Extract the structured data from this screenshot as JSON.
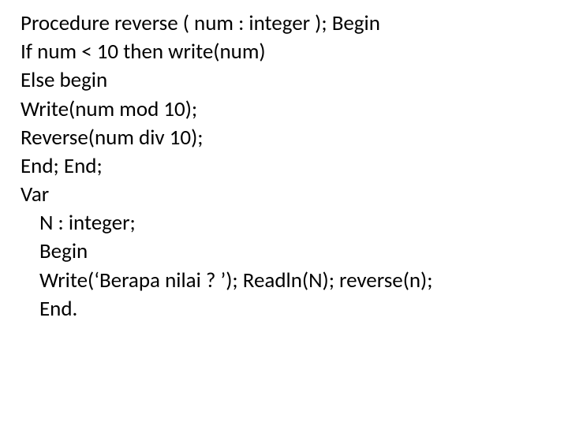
{
  "code": {
    "lines": [
      {
        "text": "Procedure reverse ( num : integer ); Begin",
        "indent": false
      },
      {
        "text": "If num < 10 then write(num)",
        "indent": false
      },
      {
        "text": "Else begin",
        "indent": false
      },
      {
        "text": "Write(num mod 10);",
        "indent": false
      },
      {
        "text": "Reverse(num div 10);",
        "indent": false
      },
      {
        "text": "End; End;",
        "indent": false
      },
      {
        "text": "Var",
        "indent": false
      },
      {
        "text": "N : integer;",
        "indent": true
      },
      {
        "text": "Begin",
        "indent": true
      },
      {
        "text": "Write(‘Berapa nilai ? ’); Readln(N); reverse(n);",
        "indent": true
      },
      {
        "text": "End.",
        "indent": true
      }
    ]
  }
}
